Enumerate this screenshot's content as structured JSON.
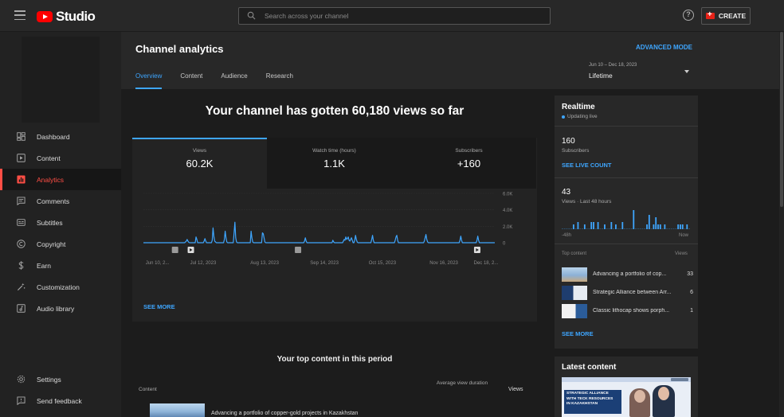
{
  "app": {
    "logo_text": "Studio",
    "brand_color": "#ff0000",
    "accent_color": "#3ea6ff",
    "active_color": "#ff4e45"
  },
  "search": {
    "placeholder": "Search across your channel"
  },
  "header": {
    "help_icon": "?",
    "create_label": "CREATE"
  },
  "nav": {
    "items": [
      {
        "label": "Dashboard",
        "icon": "dashboard-icon"
      },
      {
        "label": "Content",
        "icon": "content-icon"
      },
      {
        "label": "Analytics",
        "icon": "analytics-icon",
        "active": true
      },
      {
        "label": "Comments",
        "icon": "comments-icon"
      },
      {
        "label": "Subtitles",
        "icon": "subtitles-icon"
      },
      {
        "label": "Copyright",
        "icon": "copyright-icon"
      },
      {
        "label": "Earn",
        "icon": "earn-icon"
      },
      {
        "label": "Customization",
        "icon": "customization-icon"
      },
      {
        "label": "Audio library",
        "icon": "audio-library-icon"
      }
    ],
    "bottom": [
      {
        "label": "Settings",
        "icon": "settings-icon"
      },
      {
        "label": "Send feedback",
        "icon": "feedback-icon"
      }
    ]
  },
  "analytics": {
    "title": "Channel analytics",
    "advanced_mode": "ADVANCED MODE",
    "tabs": [
      "Overview",
      "Content",
      "Audience",
      "Research"
    ],
    "active_tab": "Overview",
    "date_range": {
      "range": "Jun 10 – Dec 18, 2023",
      "label": "Lifetime"
    },
    "headline": "Your channel has gotten 60,180 views so far",
    "metrics": [
      {
        "label": "Views",
        "value": "60.2K"
      },
      {
        "label": "Watch time (hours)",
        "value": "1.1K"
      },
      {
        "label": "Subscribers",
        "value": "+160"
      }
    ],
    "see_more": "SEE MORE"
  },
  "chart_data": {
    "type": "line",
    "series": [
      {
        "values": [
          0,
          0,
          0,
          0,
          0,
          0,
          0,
          0,
          0,
          0,
          0,
          0,
          0,
          0,
          0,
          0,
          0,
          0,
          0,
          0,
          0,
          0,
          0,
          0,
          0,
          0,
          0,
          0,
          0,
          0,
          0,
          0,
          0,
          0,
          0,
          0,
          0,
          0,
          0,
          0,
          0,
          0,
          0,
          0,
          0,
          0,
          0,
          0,
          0,
          0,
          0,
          0,
          100,
          200,
          400,
          200,
          50,
          0,
          0,
          0,
          0,
          0,
          0,
          0,
          0,
          700,
          400,
          0,
          0,
          0,
          0,
          0,
          0,
          0,
          0,
          200,
          500,
          200,
          0,
          0,
          0,
          0,
          0,
          0,
          0,
          300,
          1800,
          800,
          200,
          100,
          0,
          0,
          0,
          0,
          0,
          0,
          0,
          0,
          0,
          0,
          400,
          1400,
          600,
          100,
          0,
          0,
          0,
          0,
          0,
          0,
          0,
          0,
          1200,
          2500,
          600,
          100,
          0,
          0,
          0,
          0,
          0,
          0,
          0,
          0,
          0,
          0,
          0,
          0,
          0,
          0,
          0,
          0,
          0,
          1400,
          600,
          100,
          0,
          0,
          0,
          0,
          0,
          0,
          0,
          0,
          0,
          0,
          0,
          1200,
          1100,
          600,
          100,
          0,
          0,
          0,
          0,
          0,
          0,
          0,
          0,
          0,
          0,
          0,
          0,
          0,
          0,
          0,
          0,
          0,
          0,
          0,
          0,
          0,
          0,
          0,
          0,
          0,
          0,
          0,
          0,
          0,
          0,
          0,
          0,
          0,
          0,
          0,
          0,
          0,
          0,
          0,
          0,
          0,
          0,
          0,
          0,
          0,
          0,
          0,
          0,
          200,
          600,
          200,
          0,
          0,
          0,
          0,
          0,
          0,
          0,
          0,
          0,
          0,
          0,
          0,
          0,
          0,
          0,
          0,
          0,
          0,
          0,
          0,
          0,
          0,
          0,
          0,
          0,
          0,
          0,
          0,
          0,
          0,
          0,
          0,
          300,
          100,
          0,
          0,
          0,
          0,
          0,
          0,
          0,
          0,
          0,
          0,
          0,
          200,
          400,
          300,
          700,
          400,
          500,
          700,
          300,
          200,
          400,
          600,
          300,
          0,
          0,
          300,
          900,
          400,
          100,
          0,
          0,
          0,
          0,
          0,
          0,
          0,
          0,
          0,
          0,
          0,
          0,
          0,
          0,
          0,
          0,
          0,
          400,
          900,
          300,
          0,
          0,
          0,
          0,
          0,
          0,
          0,
          0,
          0,
          0,
          0,
          0,
          0,
          0,
          0,
          0,
          0,
          0,
          0,
          0,
          0,
          0,
          0,
          0,
          0,
          0,
          300,
          700,
          900,
          300,
          0,
          0,
          0,
          0,
          0,
          0,
          0,
          0,
          0,
          0,
          0,
          0,
          0,
          0,
          0,
          0,
          0,
          0,
          0,
          0,
          0,
          0,
          0,
          0,
          0,
          0,
          0,
          0,
          0,
          0,
          0,
          0,
          200,
          600,
          1000,
          400,
          100,
          0,
          0,
          0,
          0,
          0,
          0,
          0,
          0,
          0,
          0,
          0,
          0,
          0,
          0,
          0,
          0,
          0,
          0,
          0,
          0,
          0,
          0,
          0,
          0,
          0,
          0,
          0,
          0,
          0,
          0,
          0,
          0,
          0,
          0,
          0,
          0,
          0,
          0,
          0,
          300,
          800,
          300,
          0,
          0,
          0,
          0,
          0,
          0,
          0,
          0,
          0,
          0,
          0,
          0,
          0,
          0,
          0,
          0,
          0,
          0,
          300,
          800,
          300,
          0,
          0,
          0,
          0,
          0,
          0,
          0,
          0,
          0,
          0,
          0,
          0,
          0,
          0,
          0,
          0,
          0,
          0,
          0,
          0
        ]
      }
    ],
    "x_ticks": [
      "Jun 10, 2...",
      "Jul 12, 2023",
      "Aug 13, 2023",
      "Sep 14, 2023",
      "Oct 15, 2023",
      "Nov 16, 2023",
      "Dec 18, 2..."
    ],
    "y_ticks": [
      "6.0K",
      "4.0K",
      "2.0K",
      "0"
    ],
    "ylim": [
      0,
      6000
    ],
    "line_color": "#3ea6ff",
    "grid": true,
    "markers": [
      {
        "type": "info"
      },
      {
        "type": "play"
      },
      {
        "type": "info"
      },
      {
        "type": "play"
      }
    ]
  },
  "top_content": {
    "title": "Your top content in this period",
    "col_content": "Content",
    "col_avg": "Average view duration",
    "col_views": "Views",
    "first_row_title": "Advancing a portfolio of copper-gold projects in Kazakhstan"
  },
  "realtime": {
    "title": "Realtime",
    "status": "Updating live",
    "subscribers": "160",
    "subscribers_label": "Subscribers",
    "see_live_count": "SEE LIVE COUNT",
    "views": "43",
    "views_label": "Views · Last 48 hours",
    "bars": [
      0,
      0,
      0,
      0,
      0,
      2,
      0,
      3,
      0,
      0,
      2,
      0,
      0,
      3,
      3,
      0,
      3,
      0,
      0,
      2,
      0,
      0,
      3,
      0,
      2,
      0,
      0,
      3,
      0,
      0,
      0,
      0,
      8,
      0,
      0,
      0,
      0,
      0,
      2,
      6,
      0,
      2,
      5,
      2,
      2,
      0,
      2,
      0,
      0,
      0,
      0,
      0,
      2,
      2,
      2,
      0,
      2,
      0
    ],
    "axis_start": "-48h",
    "axis_end": "Now",
    "top_content_label": "Top content",
    "views_col": "Views",
    "items": [
      {
        "title": "Advancing a portfolio of cop...",
        "views": "33"
      },
      {
        "title": "Strategic Alliance between Arr...",
        "views": "6"
      },
      {
        "title": "Classic lithocap shows porph...",
        "views": "1"
      }
    ],
    "see_more": "SEE MORE"
  },
  "latest_content": {
    "title": "Latest content",
    "thumb_text": [
      "STRATEGIC ALLIANCE",
      "WITH TECK RESOURCES",
      "IN KAZAKHSTAN"
    ]
  }
}
